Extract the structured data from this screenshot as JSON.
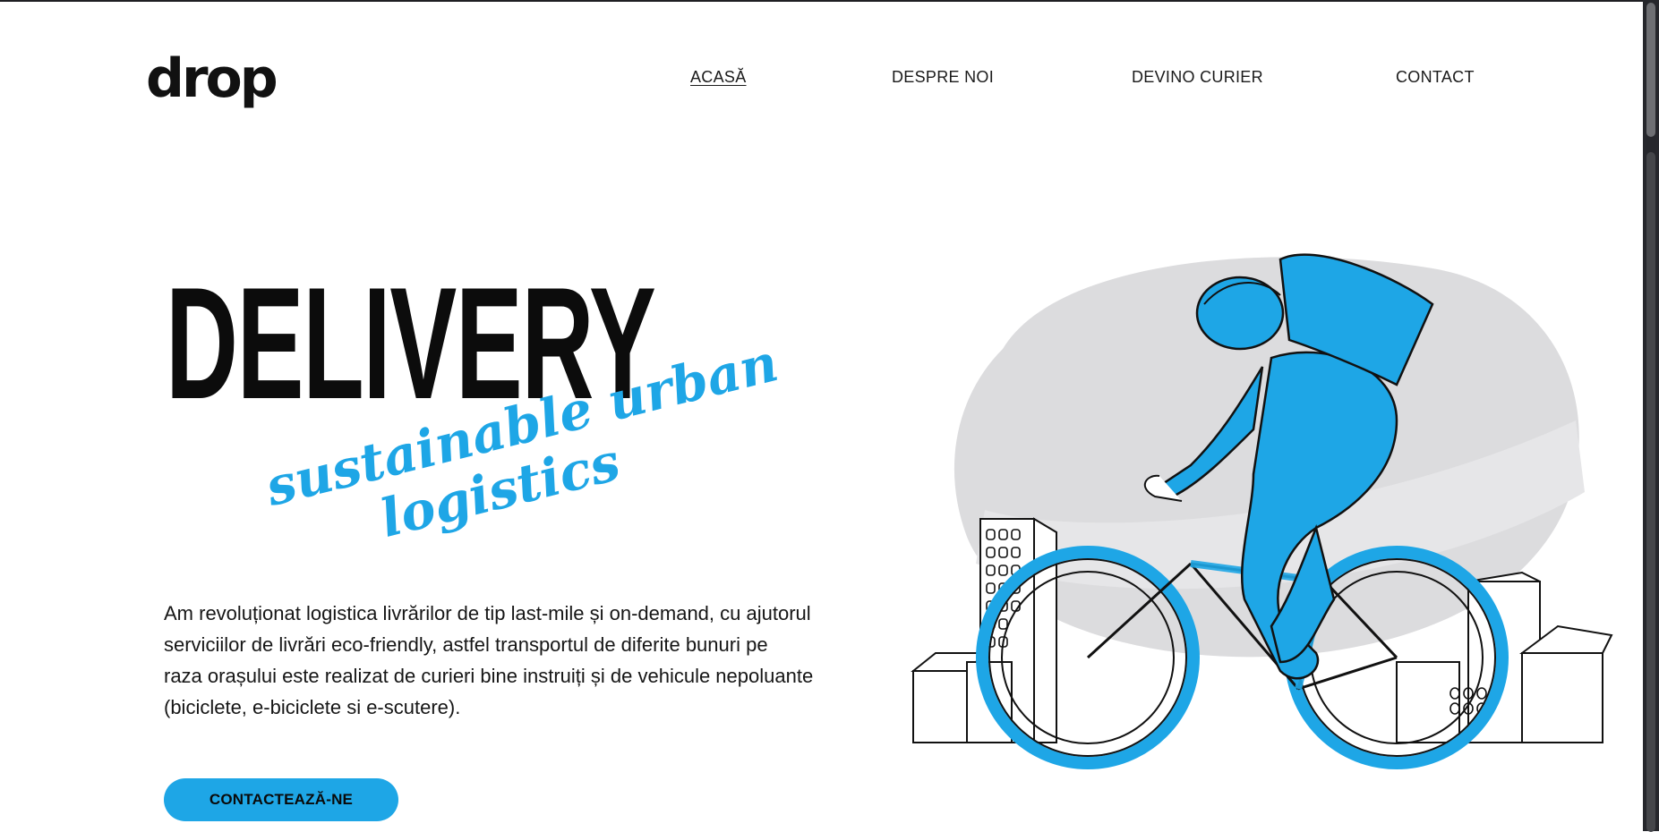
{
  "brand": {
    "logo_text": "drop"
  },
  "nav": {
    "items": [
      {
        "label": "ACASĂ",
        "active": true
      },
      {
        "label": "DESPRE NOI"
      },
      {
        "label": "DEVINO CURIER"
      },
      {
        "label": "CONTACT"
      }
    ]
  },
  "hero": {
    "title": "DELIVERY",
    "tagline_line1": "sustainable urban",
    "tagline_line2": "logistics",
    "description_lines": [
      "Am revoluționat logistica livrărilor de tip last-mile și on-demand, cu ajutorul",
      "serviciilor de livrări eco-friendly, astfel transportul de diferite bunuri pe",
      "raza orașului este realizat de curieri bine instruiți și de vehicule nepoluante",
      "(biciclete, e-biciclete si e-scutere)."
    ],
    "cta_label": "CONTACTEAZĂ-NE"
  },
  "colors": {
    "accent": "#1ea6e6",
    "text": "#111111",
    "background": "#ffffff",
    "blob": "#dcdcde"
  },
  "illustration": {
    "icon": "courier-on-bicycle-illustration"
  }
}
